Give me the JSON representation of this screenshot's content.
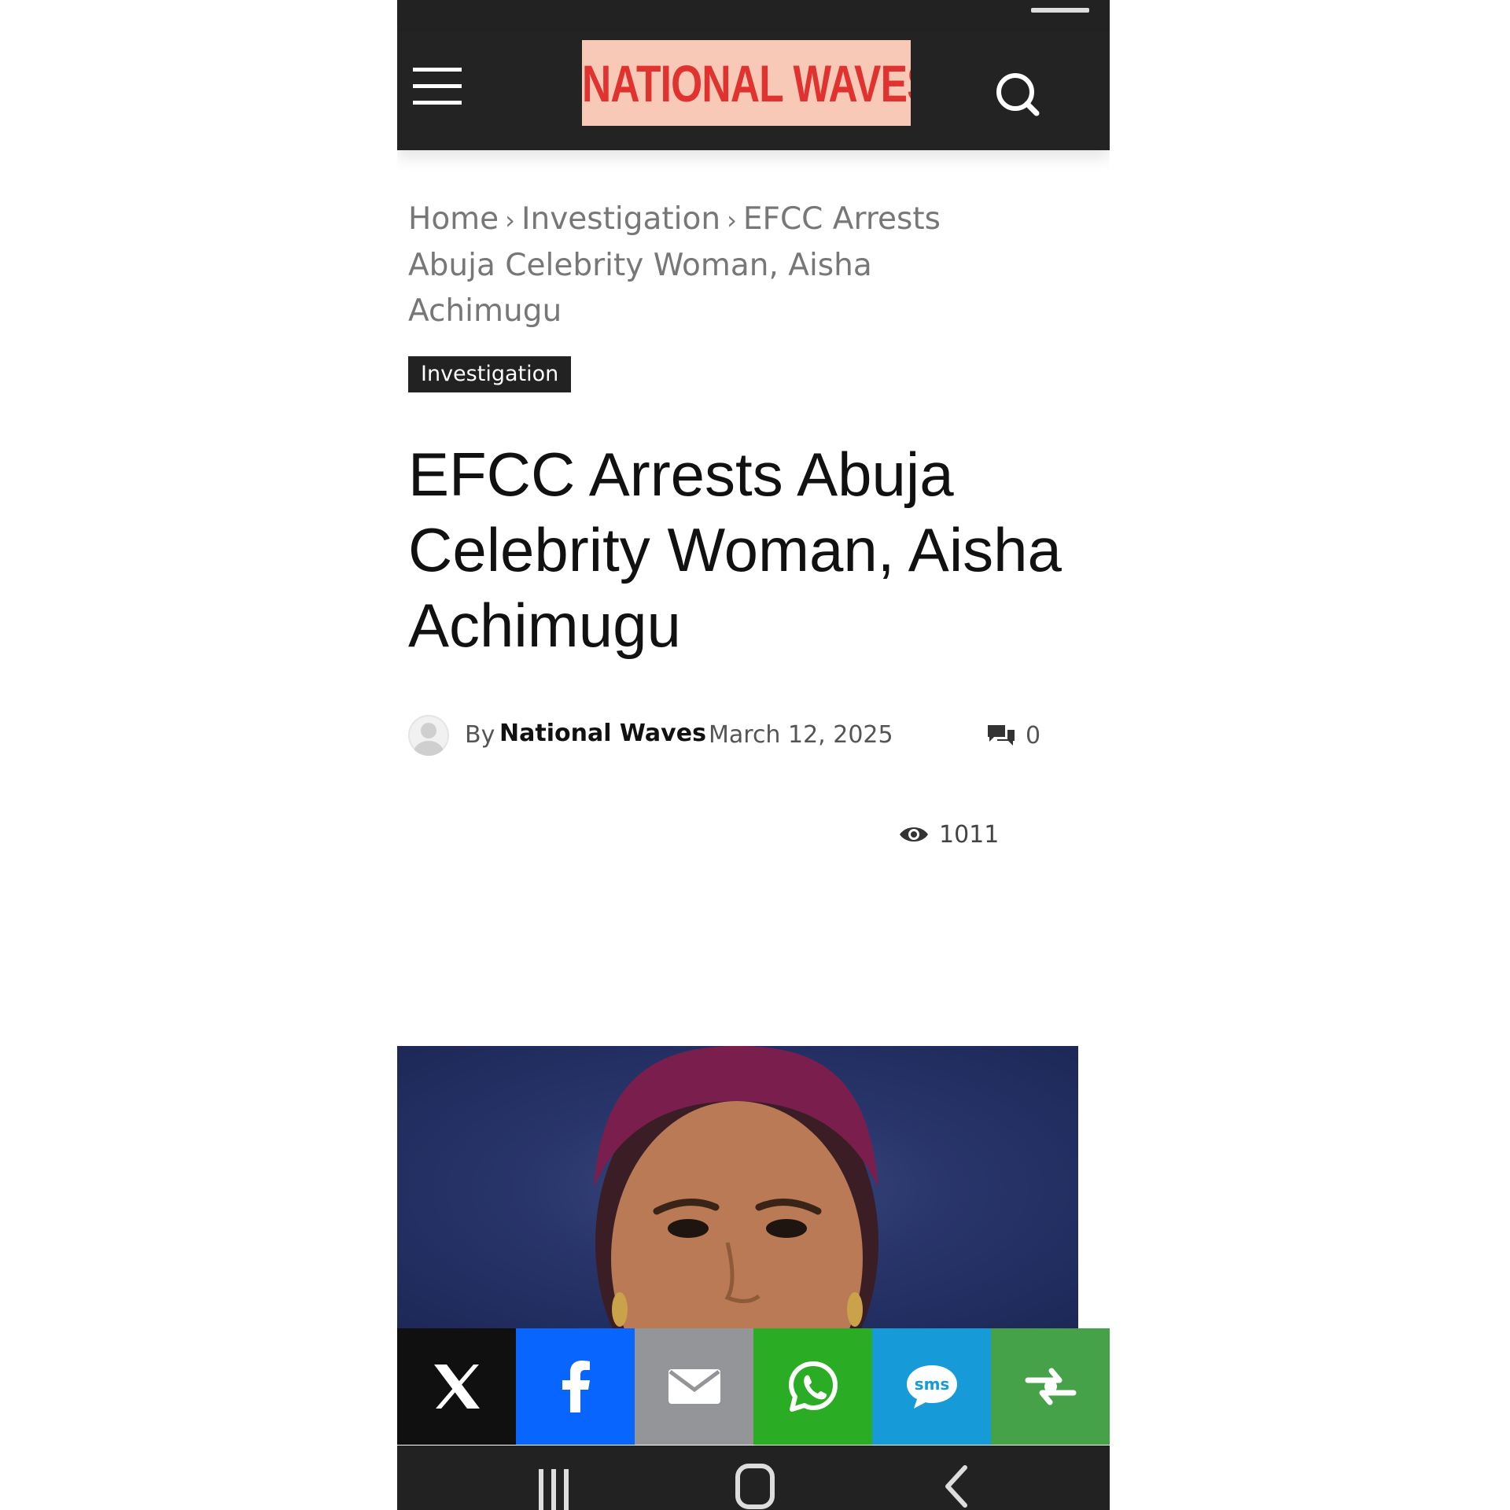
{
  "site": {
    "logo_text": "NATIONAL WAVES"
  },
  "breadcrumb": {
    "home": "Home",
    "section": "Investigation",
    "current": "EFCC Arrests Abuja Celebrity Woman, Aisha Achimugu"
  },
  "article": {
    "category": "Investigation",
    "title": "EFCC Arrests Abuja Celebrity Woman, Aisha Achimugu",
    "by_label": "By",
    "author": "National Waves",
    "date": "March 12, 2025",
    "comments": "0",
    "views": "1011"
  },
  "share": [
    {
      "network": "X",
      "icon": "x-icon",
      "color": "#101010"
    },
    {
      "network": "Facebook",
      "icon": "facebook-icon",
      "color": "#0866ff"
    },
    {
      "network": "Email",
      "icon": "email-icon",
      "color": "#939598"
    },
    {
      "network": "WhatsApp",
      "icon": "whatsapp-icon",
      "color": "#2bac25"
    },
    {
      "network": "SMS",
      "icon": "sms-icon",
      "color": "#169ad8"
    },
    {
      "network": "More",
      "icon": "more-share-icon",
      "color": "#45a249"
    }
  ],
  "colors": {
    "header_bg": "#232323",
    "logo_red": "#e0322f",
    "logo_bg": "#f8c9b6",
    "text_dark": "#111111",
    "text_muted": "#777777"
  }
}
